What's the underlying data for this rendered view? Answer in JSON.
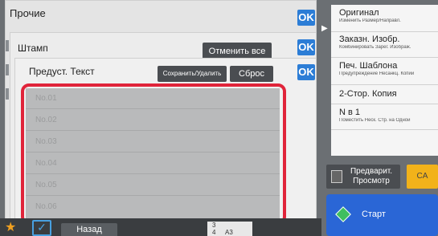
{
  "panel1": {
    "title": "Прочие",
    "ok_label": "OK"
  },
  "panel2": {
    "title": "Штамп",
    "ok_label": "OK",
    "cancel_all_label": "Отменить все"
  },
  "panel3": {
    "title": "Предуст. Текст",
    "ok_label": "OK",
    "save_delete_label": "Сохранить/Удалить",
    "reset_label": "Сброс"
  },
  "text_list": {
    "items": [
      {
        "label": "No.01"
      },
      {
        "label": "No.02"
      },
      {
        "label": "No.03"
      },
      {
        "label": "No.04"
      },
      {
        "label": "No.05"
      },
      {
        "label": "No.06"
      }
    ]
  },
  "bottom": {
    "back_label": "Назад",
    "paper": {
      "row1": "3",
      "row2": "4",
      "row2_size": "A3"
    }
  },
  "right_panel": {
    "items": [
      {
        "title": "Оригинал",
        "subtitle": "Изменить Размер/Направл."
      },
      {
        "title": "Заказн. Изобр.",
        "subtitle": "Комбинировать Зарег. Изображ."
      },
      {
        "title": "Печ. Шаблона",
        "subtitle": "Предупреждение Несанкц. Копий"
      },
      {
        "title": "2-Стор. Копия",
        "subtitle": ""
      },
      {
        "title": "N в 1",
        "subtitle": "Поместить Неск. Стр. на Одной"
      }
    ],
    "preview_label": "Предварит. Просмотр",
    "ca_label": "CA",
    "start_label": "Старт"
  },
  "colors": {
    "accent_blue": "#2c7dd6",
    "highlight_red": "#e0243a",
    "ca_yellow": "#f2b21a",
    "start_blue": "#2a66d6"
  }
}
